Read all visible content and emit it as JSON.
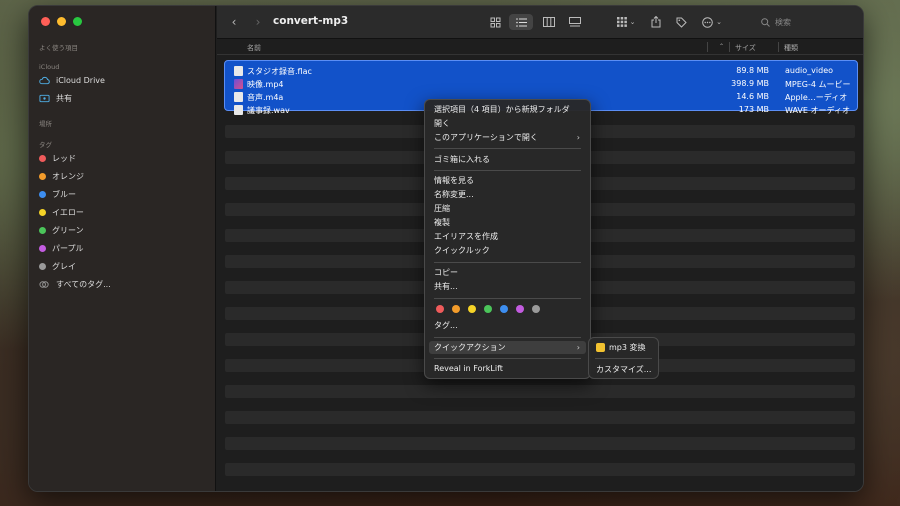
{
  "window": {
    "title": "convert-mp3"
  },
  "sidebar": {
    "favorites_header": "よく使う項目",
    "icloud_header": "iCloud",
    "icloud_items": [
      {
        "label": "iCloud Drive",
        "icon": "cloud-icon"
      },
      {
        "label": "共有",
        "icon": "shared-folder-icon"
      }
    ],
    "locations_header": "場所",
    "tags_header": "タグ",
    "tags": [
      {
        "label": "レッド",
        "color": "#ef5b5b"
      },
      {
        "label": "オレンジ",
        "color": "#f39c2b"
      },
      {
        "label": "ブルー",
        "color": "#3d8ef0"
      },
      {
        "label": "イエロー",
        "color": "#f5d327"
      },
      {
        "label": "グリーン",
        "color": "#4bc55a"
      },
      {
        "label": "パープル",
        "color": "#c35ce0"
      },
      {
        "label": "グレイ",
        "color": "#9a9a9a"
      }
    ],
    "all_tags": "すべてのタグ..."
  },
  "search": {
    "placeholder": "検索"
  },
  "columns": {
    "name": "名前",
    "size": "サイズ",
    "kind": "種類"
  },
  "files": [
    {
      "name": "スタジオ録音.flac",
      "size": "89.8 MB",
      "kind": "audio_video",
      "icon": "audio-file-icon"
    },
    {
      "name": "映像.mp4",
      "size": "398.9 MB",
      "kind": "MPEG-4 ムービー",
      "icon": "video-file-icon"
    },
    {
      "name": "音声.m4a",
      "size": "14.6 MB",
      "kind": "Apple…ーディオ",
      "icon": "audio-file-icon"
    },
    {
      "name": "議事録.wav",
      "size": "173 MB",
      "kind": "WAVE オーディオ",
      "icon": "audio-file-icon"
    }
  ],
  "context_menu": {
    "new_folder": "選択項目（4 項目）から新規フォルダ",
    "open": "開く",
    "open_with": "このアプリケーションで開く",
    "trash": "ゴミ箱に入れる",
    "get_info": "情報を見る",
    "rename": "名称変更...",
    "compress": "圧縮",
    "duplicate": "複製",
    "alias": "エイリアスを作成",
    "quick_look": "クイックルック",
    "copy": "コピー",
    "share": "共有...",
    "tag_colors": [
      "#ef5b5b",
      "#f39c2b",
      "#f5d327",
      "#4bc55a",
      "#3d8ef0",
      "#c35ce0",
      "#9a9a9a"
    ],
    "tags": "タグ...",
    "quick_actions": "クイックアクション",
    "reveal": "Reveal in ForkLift"
  },
  "submenu": {
    "mp3": "mp3 変換",
    "customize": "カスタマイズ..."
  }
}
